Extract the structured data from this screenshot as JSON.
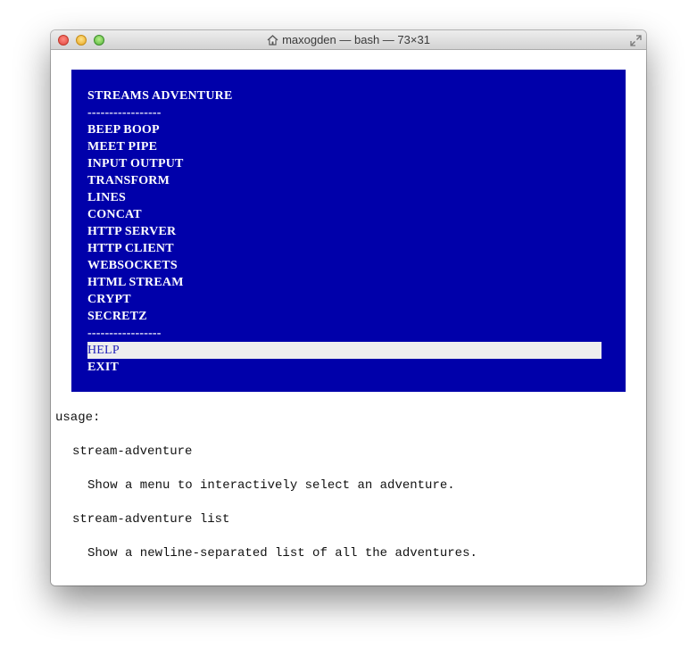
{
  "window": {
    "title": "maxogden — bash — 73×31"
  },
  "menu": {
    "heading": "STREAMS ADVENTURE",
    "separator_top": "-----------------",
    "items": [
      "BEEP BOOP",
      "MEET PIPE",
      "INPUT OUTPUT",
      "TRANSFORM",
      "LINES",
      "CONCAT",
      "HTTP SERVER",
      "HTTP CLIENT",
      "WEBSOCKETS",
      "HTML STREAM",
      "CRYPT",
      "SECRETZ"
    ],
    "separator_bottom": "-----------------",
    "help": "HELP",
    "exit": "EXIT",
    "colors": {
      "background": "#0000aa",
      "text": "#ffffff",
      "selected_bg": "#eeeeee",
      "selected_text": "#2222bb"
    }
  },
  "output": {
    "usage": "usage:",
    "cmd1": "stream-adventure",
    "desc1": "Show a menu to interactively select an adventure.",
    "cmd2": "stream-adventure list",
    "desc2": "Show a newline-separated list of all the adventures."
  }
}
